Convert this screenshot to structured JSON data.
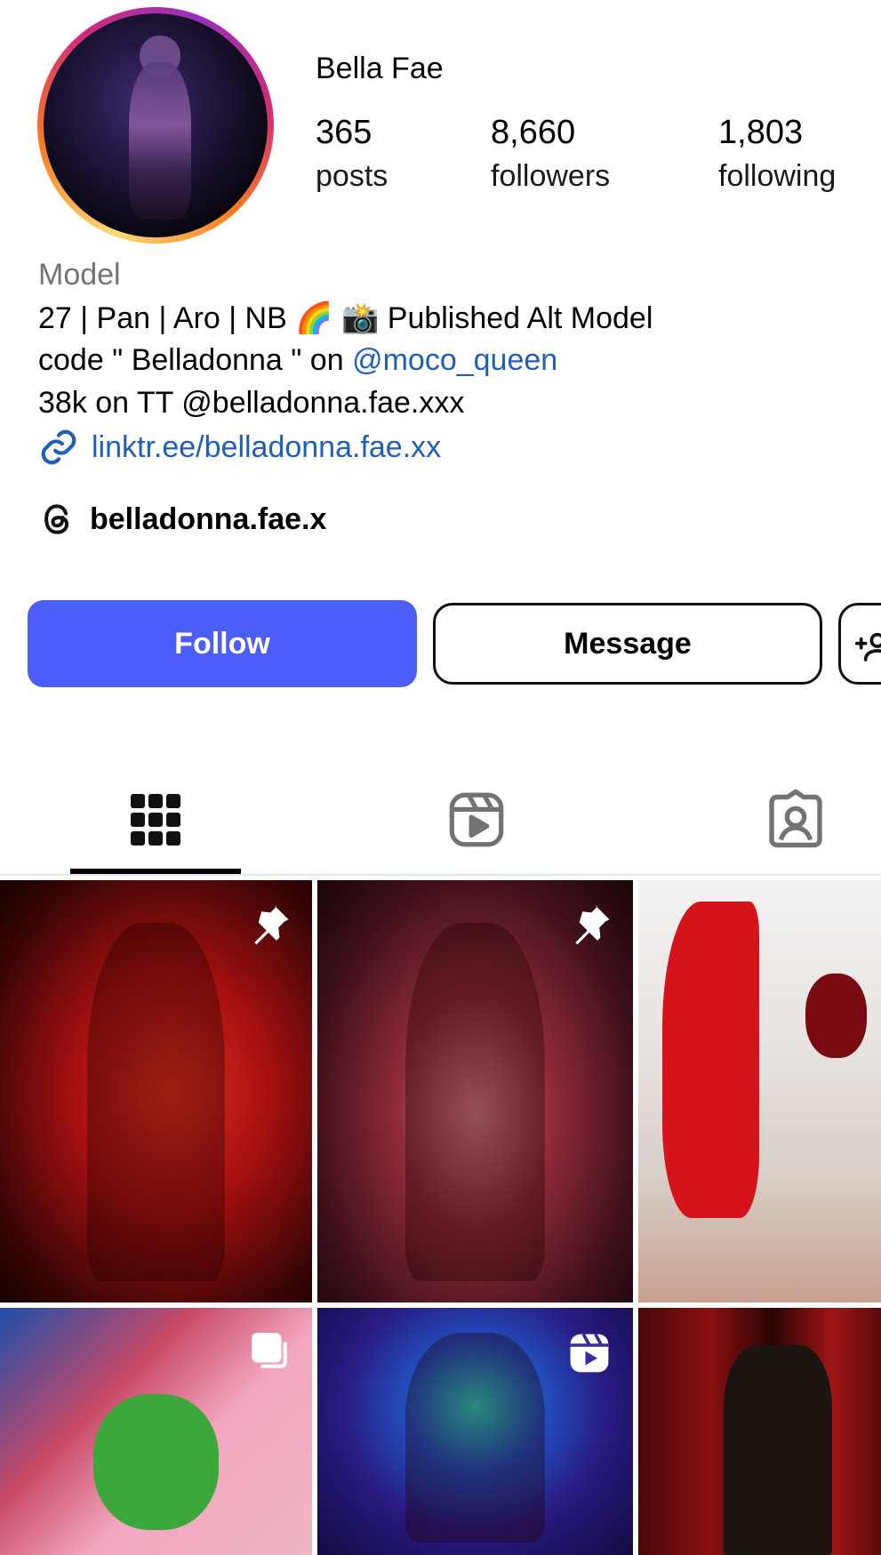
{
  "profile": {
    "name": "Bella Fae",
    "stats": [
      {
        "value": "365",
        "label": "posts"
      },
      {
        "value": "8,660",
        "label": "followers"
      },
      {
        "value": "1,803",
        "label": "following"
      }
    ],
    "category": "Model",
    "bio": {
      "line1": "27 | Pan | Aro | NB 🌈  📸 Published Alt Model",
      "line2_prefix": "code \" Belladonna \" on ",
      "line2_mention": "@moco_queen",
      "line3": "38k on TT @belladonna.fae.xxx"
    },
    "link": "linktr.ee/belladonna.fae.xx",
    "threads_handle": "belladonna.fae.x"
  },
  "actions": {
    "follow_label": "Follow",
    "message_label": "Message",
    "follow_color": "#4c5ef9"
  },
  "tabs": [
    {
      "icon": "grid-icon",
      "selected": true
    },
    {
      "icon": "reels-icon",
      "selected": false
    },
    {
      "icon": "tagged-icon",
      "selected": false
    }
  ],
  "posts": [
    {
      "badge": "pin-icon"
    },
    {
      "badge": "pin-icon"
    },
    {
      "badge": ""
    },
    {
      "badge": "carousel-icon"
    },
    {
      "badge": "reel-icon"
    },
    {
      "badge": ""
    }
  ],
  "colors": {
    "link": "#1f5fb8",
    "category": "#737373"
  }
}
